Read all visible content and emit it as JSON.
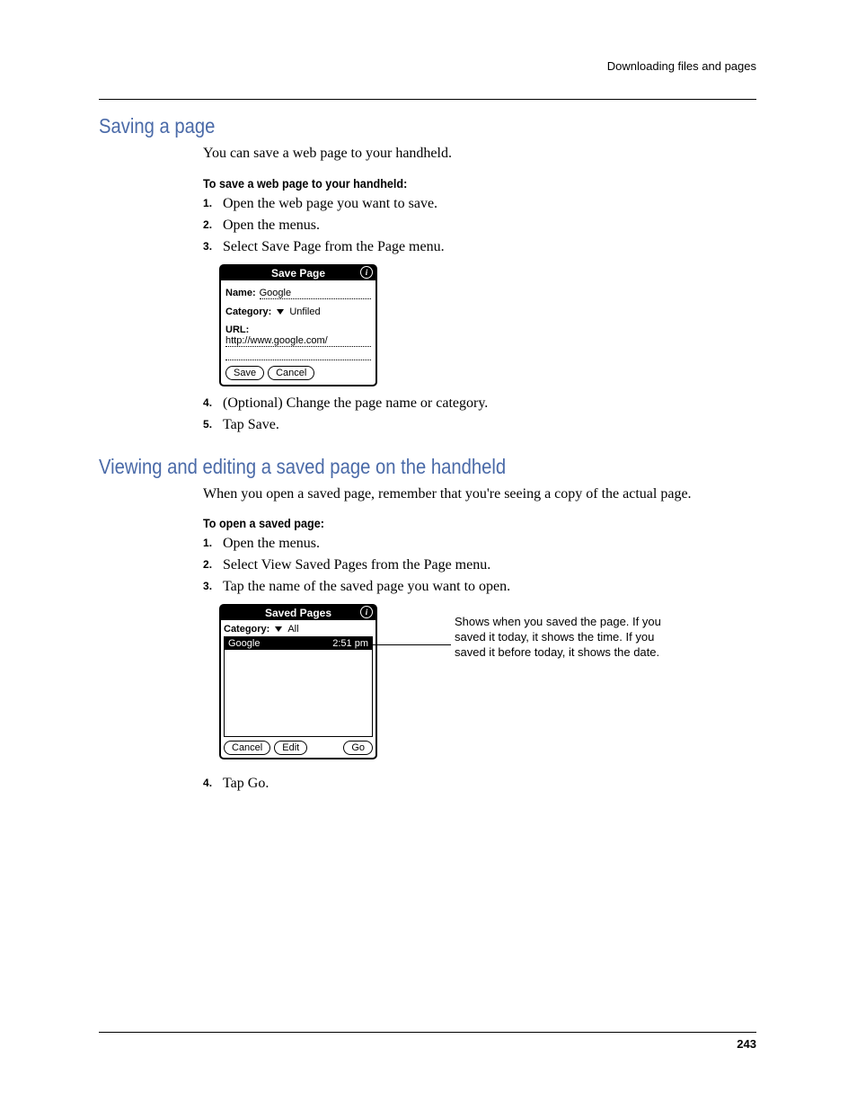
{
  "header": {
    "breadcrumb": "Downloading files and pages"
  },
  "section1": {
    "heading": "Saving a page",
    "intro": "You can save a web page to your handheld.",
    "subhead": "To save a web page to your handheld:",
    "steps_a": [
      "Open the web page you want to save.",
      "Open the menus.",
      "Select Save Page from the Page menu."
    ],
    "steps_b": [
      "(Optional) Change the page name or category.",
      "Tap Save."
    ]
  },
  "dialog1": {
    "title": "Save Page",
    "name_label": "Name:",
    "name_value": "Google",
    "category_label": "Category:",
    "category_value": "Unfiled",
    "url_label": "URL:",
    "url_value": "http://www.google.com/",
    "save_btn": "Save",
    "cancel_btn": "Cancel"
  },
  "section2": {
    "heading": "Viewing and editing a saved page on the handheld",
    "intro": "When you open a saved page, remember that you're seeing a copy of the actual page.",
    "subhead": "To open a saved page:",
    "steps_a": [
      "Open the menus.",
      "Select View Saved Pages from the Page menu.",
      "Tap the name of the saved page you want to open."
    ],
    "steps_b": [
      "Tap Go."
    ]
  },
  "dialog2": {
    "title": "Saved Pages",
    "category_label": "Category:",
    "category_value": "All",
    "rows": [
      {
        "name": "Google",
        "time": "2:51 pm"
      }
    ],
    "cancel_btn": "Cancel",
    "edit_btn": "Edit",
    "go_btn": "Go"
  },
  "callout": "Shows when you saved the page. If you saved it today, it shows the time. If you saved it before today, it shows the date.",
  "footer": {
    "page_number": "243"
  }
}
